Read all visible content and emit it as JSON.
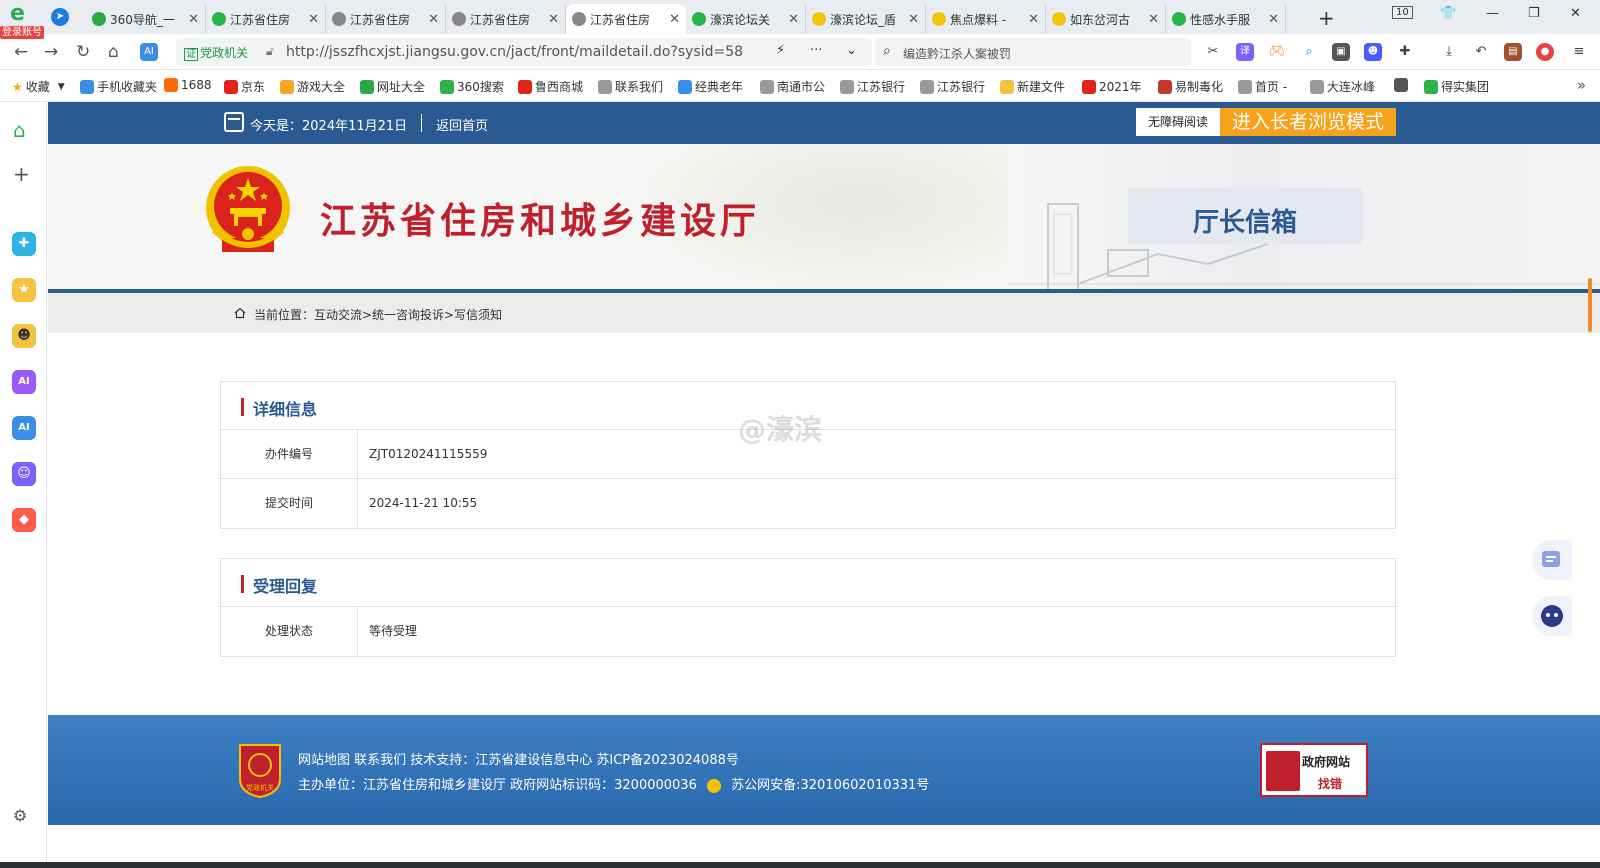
{
  "browser": {
    "login_badge": "登录账号",
    "tabs": [
      {
        "title": "360导航_一",
        "color": "#2aa84a"
      },
      {
        "title": "江苏省住房",
        "color": "#2bb24c"
      },
      {
        "title": "江苏省住房",
        "color": "#888888"
      },
      {
        "title": "江苏省住房",
        "color": "#888888"
      },
      {
        "title": "江苏省住房",
        "color": "#888888"
      },
      {
        "title": "濠滨论坛关",
        "color": "#2bb24c"
      },
      {
        "title": "濠滨论坛_盾",
        "color": "#f1c40f"
      },
      {
        "title": "焦点爆料 -",
        "color": "#f1c40f"
      },
      {
        "title": "如东岔河古",
        "color": "#f1c40f"
      },
      {
        "title": "性感水手服",
        "color": "#2bb24c"
      }
    ],
    "active_tab_index": 4,
    "tab_count": "10",
    "gov_tag": "党政机关",
    "gov_tag_mark": "证",
    "url": "http://jsszfhcxjst.jiangsu.gov.cn/jact/front/maildetail.do?sysid=58",
    "search_placeholder": "编造黔江杀人案被罚",
    "bookmarks": [
      {
        "label": "收藏",
        "color": "#f5a623"
      },
      {
        "label": "手机收藏夹",
        "color": "#3a8ee6"
      },
      {
        "label": "1688",
        "color": "#ff6a00"
      },
      {
        "label": "京东",
        "color": "#e1251b"
      },
      {
        "label": "游戏大全",
        "color": "#f5a623"
      },
      {
        "label": "网址大全",
        "color": "#2aa84a"
      },
      {
        "label": "360搜索",
        "color": "#2bb24c"
      },
      {
        "label": "鲁西商城",
        "color": "#e1251b"
      },
      {
        "label": "联系我们",
        "color": "#999999"
      },
      {
        "label": "经典老年",
        "color": "#3a8ee6"
      },
      {
        "label": "南通市公",
        "color": "#999999"
      },
      {
        "label": "江苏银行",
        "color": "#999999"
      },
      {
        "label": "江苏银行",
        "color": "#999999"
      },
      {
        "label": "新建文件",
        "color": "#f5c342"
      },
      {
        "label": "2021年",
        "color": "#e1251b"
      },
      {
        "label": "易制毒化",
        "color": "#c0392b"
      },
      {
        "label": "首页 -",
        "color": "#999999"
      },
      {
        "label": "大连冰峰",
        "color": "#999999"
      },
      {
        "label": "",
        "color": "#555555"
      },
      {
        "label": "得实集团",
        "color": "#2bb24c"
      }
    ]
  },
  "site": {
    "today": "今天是：2024年11月21日",
    "back_home": "返回首页",
    "accessibility": "无障碍阅读",
    "elder_mode": "进入长者浏览模式",
    "title": "江苏省住房和城乡建设厅",
    "mailbox": "厅长信箱",
    "breadcrumb": "当前位置：互动交流>统一咨询投诉>写信须知",
    "watermark": "@濠滨"
  },
  "detail": {
    "heading": "详细信息",
    "rows": [
      {
        "label": "办件编号",
        "value": "ZJT0120241115559"
      },
      {
        "label": "提交时间",
        "value": "2024-11-21 10:55"
      }
    ]
  },
  "reply": {
    "heading": "受理回复",
    "rows": [
      {
        "label": "处理状态",
        "value": "等待受理"
      }
    ]
  },
  "footer": {
    "line1": "网站地图   联系我们   技术支持：江苏省建设信息中心 苏ICP备2023024088号",
    "line2_a": "主办单位：江苏省住房和城乡建设厅  政府网站标识码：3200000036",
    "line2_b": "苏公网安备:32010602010331号",
    "badge_text": "党政机关",
    "gov_err_line1": "政府网站",
    "gov_err_line2": "找错"
  }
}
